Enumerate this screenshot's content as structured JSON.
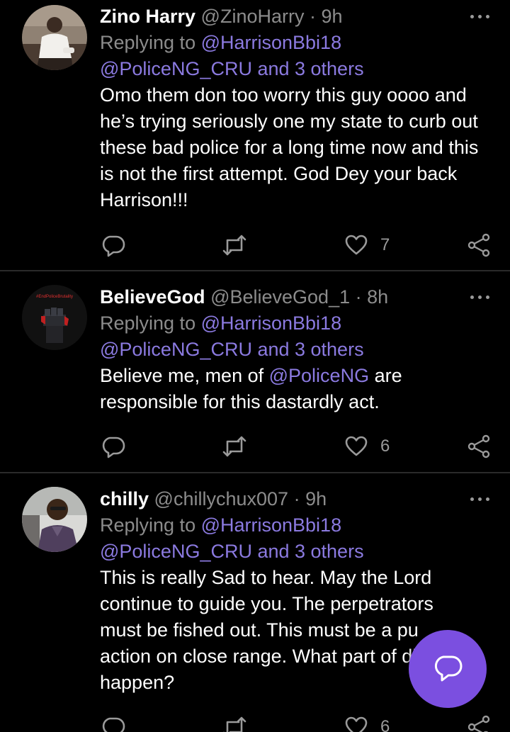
{
  "colors": {
    "background": "#000000",
    "accent": "#8b7ae0",
    "fab": "#7b4fe0",
    "muted": "#8c8c8c"
  },
  "tweets": [
    {
      "display_name": "Zino Harry",
      "handle": "@ZinoHarry",
      "dot": "·",
      "time": "9h",
      "replying_prefix": "Replying to ",
      "replying_to": "@HarrisonBbi18",
      "replying_more": "@PoliceNG_CRU and 3 others",
      "text": "Omo them don too worry this guy oooo and he’s trying seriously one my state to curb out these bad police for a long time now and this is not the first attempt. God Dey your back Harrison!!!",
      "likes": "7",
      "icons": [
        "reply-icon",
        "retweet-icon",
        "like-icon",
        "share-icon",
        "more-icon"
      ]
    },
    {
      "display_name": "BelieveGod",
      "handle": "@BelieveGod_1",
      "dot": "·",
      "time": "8h",
      "replying_prefix": "Replying to ",
      "replying_to": "@HarrisonBbi18",
      "replying_more": "@PoliceNG_CRU and 3 others",
      "text_before": "Believe me, men of ",
      "text_mention": "@PoliceNG",
      "text_after": " are responsible for this dastardly act.",
      "likes": "6",
      "avatar_text": "#EndPoliceBrutality"
    },
    {
      "display_name": "chilly",
      "handle": "@chillychux007",
      "dot": "·",
      "time": "9h",
      "replying_prefix": "Replying to ",
      "replying_to": "@HarrisonBbi18",
      "replying_more": "@PoliceNG_CRU and 3 others",
      "text": "This is really Sad to hear. May the Lord continue to guide you. The perpetrators must be fished out. This must be a pu action on close range. What part of did this happen?",
      "likes": "6"
    }
  ],
  "fab": {
    "icon": "compose-message-icon"
  }
}
